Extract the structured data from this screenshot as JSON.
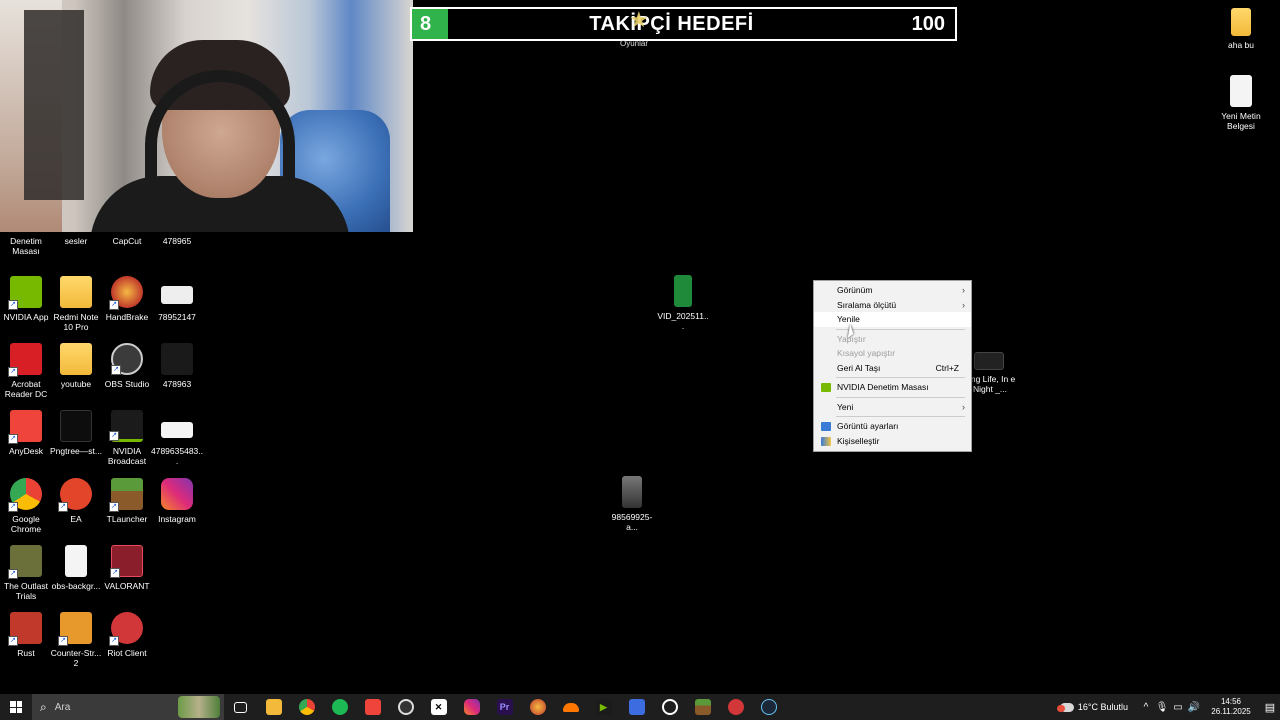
{
  "goal": {
    "count": "8",
    "title": "TAKİPÇİ HEDEFİ",
    "target": "100",
    "sub_label": "Oyunlar"
  },
  "desktop_icons": [
    {
      "label": "Denetim Masası",
      "icon": "control-panel-icon",
      "color": "#2b6fd6"
    },
    {
      "label": "sesler",
      "icon": "folder-icon",
      "color": "#f2b93a"
    },
    {
      "label": "CapCut",
      "icon": "capcut-icon",
      "color": "#222222"
    },
    {
      "label": "478965",
      "icon": "image-file-icon",
      "color": "#333333"
    },
    {
      "label": "NVIDIA App",
      "icon": "nvidia-app-icon",
      "color": "#76b900"
    },
    {
      "label": "Redmi Note 10 Pro",
      "icon": "folder-icon",
      "color": "#f2b93a"
    },
    {
      "label": "HandBrake",
      "icon": "handbrake-icon",
      "color": "#c0392b"
    },
    {
      "label": "78952147",
      "icon": "image-file-icon",
      "color": "#eeeeee"
    },
    {
      "label": "Acrobat Reader DC",
      "icon": "acrobat-icon",
      "color": "#d81f26"
    },
    {
      "label": "youtube",
      "icon": "folder-icon",
      "color": "#f2b93a"
    },
    {
      "label": "OBS Studio",
      "icon": "obs-icon",
      "color": "#3b3b3b"
    },
    {
      "label": "478963",
      "icon": "image-file-icon",
      "color": "#222222"
    },
    {
      "label": "AnyDesk",
      "icon": "anydesk-icon",
      "color": "#ef443b"
    },
    {
      "label": "Pngtree—st...",
      "icon": "image-file-icon",
      "color": "#0d0d0d"
    },
    {
      "label": "NVIDIA Broadcast",
      "icon": "nvidia-broadcast-icon",
      "color": "#76b900"
    },
    {
      "label": "4789635483...",
      "icon": "image-file-icon",
      "color": "#f4f4f4"
    },
    {
      "label": "Google Chrome",
      "icon": "chrome-icon",
      "color": "#4285f4"
    },
    {
      "label": "EA",
      "icon": "ea-icon",
      "color": "#e3452a"
    },
    {
      "label": "TLauncher",
      "icon": "tlauncher-icon",
      "color": "#5b9a3a"
    },
    {
      "label": "Instagram",
      "icon": "instagram-icon",
      "color": "#c13584"
    },
    {
      "label": "The Outlast Trials",
      "icon": "outlast-icon",
      "color": "#6b6f3a"
    },
    {
      "label": "obs-backgr...",
      "icon": "text-file-icon",
      "color": "#f4f4f4"
    },
    {
      "label": "VALORANT",
      "icon": "valorant-icon",
      "color": "#8a1f2b"
    },
    {
      "label": "Rust",
      "icon": "rust-icon",
      "color": "#c0392b"
    },
    {
      "label": "Counter-Str... 2",
      "icon": "counter-strike-icon",
      "color": "#e79a2b"
    },
    {
      "label": "Riot Client",
      "icon": "riot-client-icon",
      "color": "#d13639"
    }
  ],
  "right_icons": [
    {
      "label": "aha bu",
      "icon": "folder-icon"
    },
    {
      "label": "Yeni Metin Belgesi",
      "icon": "text-file-icon"
    }
  ],
  "floating_icons": [
    {
      "label": "VID_202511...",
      "icon": "video-file-icon"
    },
    {
      "label": "98569925-a...",
      "icon": "image-file-icon"
    },
    {
      "label": "ving Life, In e Night _...",
      "icon": "image-file-icon"
    }
  ],
  "context_menu": {
    "items": [
      {
        "label": "Görünüm",
        "submenu": true,
        "disabled": false
      },
      {
        "label": "Sıralama ölçütü",
        "submenu": true,
        "disabled": false
      },
      {
        "label": "Yenile",
        "submenu": false,
        "disabled": false
      },
      {
        "label": "Yapıştır",
        "submenu": false,
        "disabled": true
      },
      {
        "label": "Kısayol yapıştır",
        "submenu": false,
        "disabled": true
      },
      {
        "label": "Geri Al Taşı",
        "shortcut": "Ctrl+Z",
        "submenu": false,
        "disabled": false
      },
      {
        "label": "NVIDIA Denetim Masası",
        "submenu": false,
        "disabled": false
      },
      {
        "label": "Yeni",
        "submenu": true,
        "disabled": false
      },
      {
        "label": "Görüntü ayarları",
        "submenu": false,
        "disabled": false
      },
      {
        "label": "Kişiselleştir",
        "submenu": false,
        "disabled": false
      }
    ]
  },
  "taskbar": {
    "search_placeholder": "Ara",
    "weather": "16°C Bulutlu",
    "time": "14:56",
    "date": "26.11.2025"
  }
}
